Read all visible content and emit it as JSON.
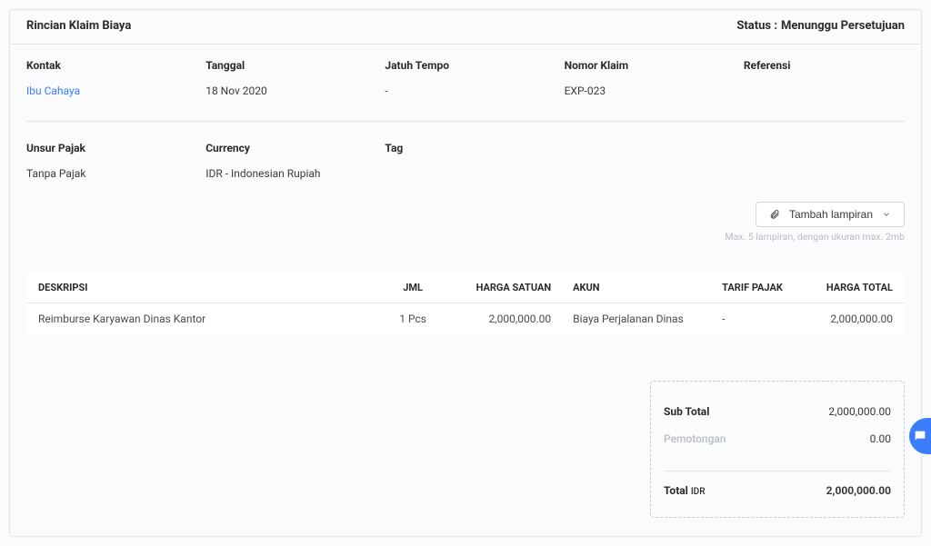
{
  "header": {
    "title": "Rincian Klaim Biaya",
    "status_label": "Status :",
    "status_value": "Menunggu Persetujuan"
  },
  "info_row1": {
    "kontak_label": "Kontak",
    "kontak_value": "Ibu Cahaya",
    "tanggal_label": "Tanggal",
    "tanggal_value": "18 Nov 2020",
    "jatuh_label": "Jatuh Tempo",
    "jatuh_value": "-",
    "nomor_label": "Nomor Klaim",
    "nomor_value": "EXP-023",
    "ref_label": "Referensi",
    "ref_value": ""
  },
  "info_row2": {
    "pajak_label": "Unsur Pajak",
    "pajak_value": "Tanpa Pajak",
    "currency_label": "Currency",
    "currency_value": "IDR - Indonesian Rupiah",
    "tag_label": "Tag",
    "tag_value": ""
  },
  "attachment": {
    "button_label": "Tambah lampiran",
    "hint": "Max. 5 lampiran, dengan ukuran max. 2mb"
  },
  "table": {
    "headers": {
      "deskripsi": "DESKRIPSI",
      "jml": "JML",
      "harga_satuan": "HARGA SATUAN",
      "akun": "AKUN",
      "tarif_pajak": "TARIF PAJAK",
      "harga_total": "HARGA TOTAL"
    },
    "rows": [
      {
        "deskripsi": "Reimburse Karyawan Dinas Kantor",
        "jml": "1 Pcs",
        "harga_satuan": "2,000,000.00",
        "akun": "Biaya Perjalanan Dinas",
        "tarif_pajak": "-",
        "harga_total": "2,000,000.00"
      }
    ]
  },
  "summary": {
    "subtotal_label": "Sub Total",
    "subtotal_value": "2,000,000.00",
    "pemotongan_label": "Pemotongan",
    "pemotongan_value": "0.00",
    "total_label": "Total",
    "total_currency": "IDR",
    "total_value": "2,000,000.00"
  }
}
